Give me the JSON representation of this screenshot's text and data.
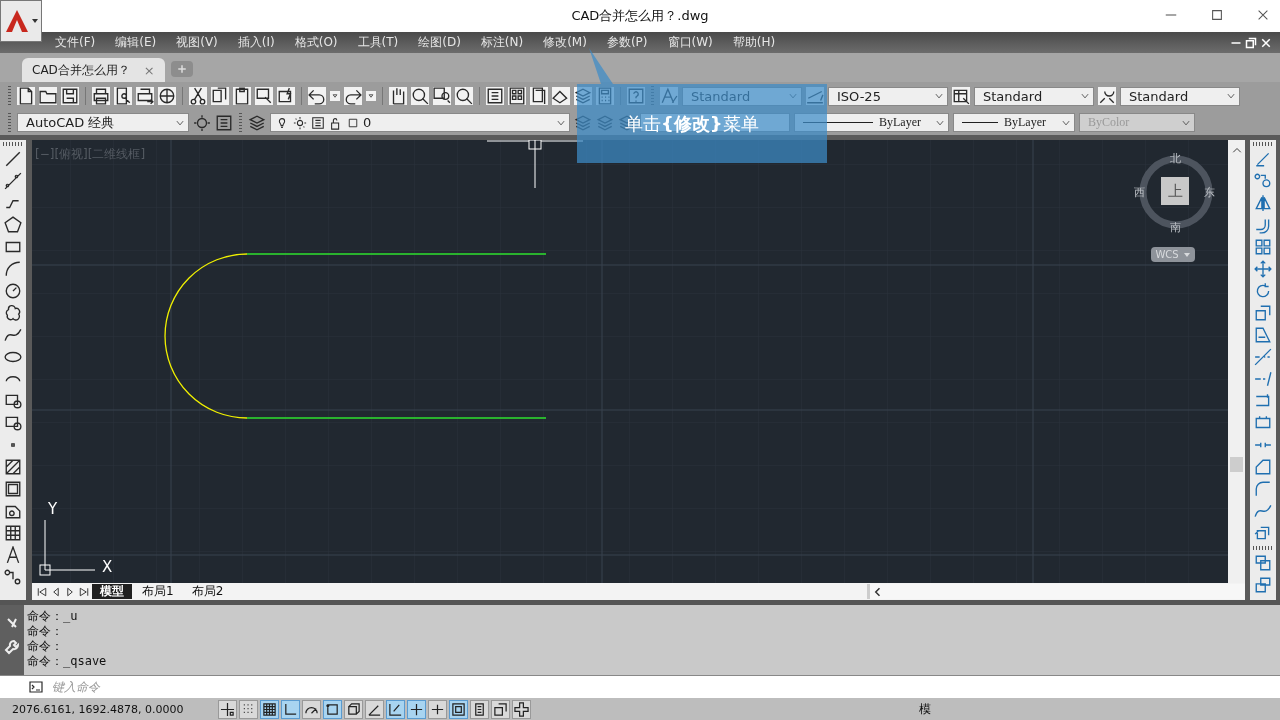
{
  "window": {
    "title": "CAD合并怎么用？.dwg"
  },
  "menu": [
    "文件(F)",
    "编辑(E)",
    "视图(V)",
    "插入(I)",
    "格式(O)",
    "工具(T)",
    "绘图(D)",
    "标注(N)",
    "修改(M)",
    "参数(P)",
    "窗口(W)",
    "帮助(H)"
  ],
  "doc_tabs": [
    {
      "label": "CAD合并怎么用？",
      "close": "×",
      "selected": true
    }
  ],
  "toolbar": {
    "text_style": "Standard",
    "dim_style": "ISO-25",
    "table_style": "Standard",
    "multileader_style": "Standard",
    "workspace": "AutoCAD 经典",
    "layer": "0",
    "linetype": "ByLayer",
    "lineweight": "ByLayer",
    "plot_style": {
      "value": "ByColor",
      "disabled": true
    }
  },
  "callout": {
    "text": "单击**{修改}**菜单"
  },
  "viewport": {
    "label": "[−][俯视][二维线框]"
  },
  "viewcube": {
    "north": "北",
    "south": "南",
    "east": "东",
    "west": "西",
    "face": "上",
    "ucs": "WCS"
  },
  "ucs_icon": {
    "x": "X",
    "y": "Y"
  },
  "layout_tabs": [
    {
      "label": "模型",
      "selected": true
    },
    {
      "label": "布局1",
      "selected": false
    },
    {
      "label": "布局2",
      "selected": false
    }
  ],
  "command": {
    "history": [
      "命令：_u",
      "命令：",
      "命令：",
      "命令：_qsave"
    ],
    "placeholder": "键入命令"
  },
  "status_bar": {
    "coordinates": "2076.6161, 1692.4878, 0.0000",
    "toggles": [
      {
        "on": false
      },
      {
        "on": false
      },
      {
        "on": true
      },
      {
        "on": true
      },
      {
        "on": false
      },
      {
        "on": true
      },
      {
        "on": false
      },
      {
        "on": false
      },
      {
        "on": true
      },
      {
        "on": true
      },
      {
        "on": false
      },
      {
        "on": true
      },
      {
        "on": false
      },
      {
        "on": false
      },
      {
        "on": false
      }
    ],
    "model": "模"
  }
}
